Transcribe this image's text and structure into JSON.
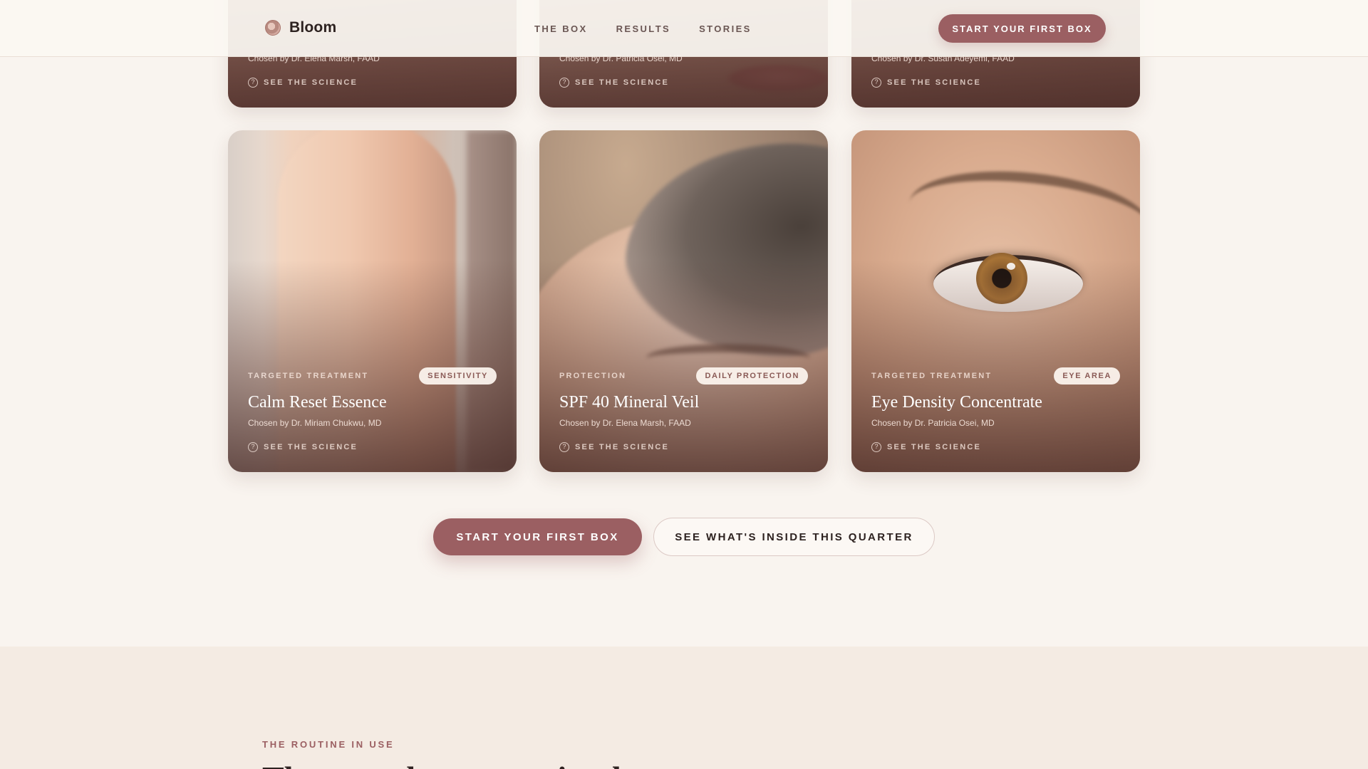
{
  "header": {
    "brand": "Bloom",
    "nav": [
      "THE BOX",
      "RESULTS",
      "STORIES"
    ],
    "cta": "START YOUR FIRST BOX"
  },
  "cards_top": [
    {
      "chosen_by": "Chosen by Dr. Elena Marsh, FAAD",
      "science": "SEE THE SCIENCE"
    },
    {
      "chosen_by": "Chosen by Dr. Patricia Osei, MD",
      "science": "SEE THE SCIENCE"
    },
    {
      "chosen_by": "Chosen by Dr. Susan Adeyemi, FAAD",
      "science": "SEE THE SCIENCE"
    }
  ],
  "cards": [
    {
      "category": "TARGETED TREATMENT",
      "tag": "SENSITIVITY",
      "title": "Calm Reset Essence",
      "chosen_by": "Chosen by Dr. Miriam Chukwu, MD",
      "science": "SEE THE SCIENCE"
    },
    {
      "category": "PROTECTION",
      "tag": "DAILY PROTECTION",
      "title": "SPF 40 Mineral Veil",
      "chosen_by": "Chosen by Dr. Elena Marsh, FAAD",
      "science": "SEE THE SCIENCE"
    },
    {
      "category": "TARGETED TREATMENT",
      "tag": "EYE AREA",
      "title": "Eye Density Concentrate",
      "chosen_by": "Chosen by Dr. Patricia Osei, MD",
      "science": "SEE THE SCIENCE"
    }
  ],
  "cta_row": {
    "primary": "START YOUR FIRST BOX",
    "secondary": "SEE WHAT'S INSIDE THIS QUARTER"
  },
  "next_section": {
    "eyebrow": "THE ROUTINE IN USE",
    "heading": "Three weeks, a new ritual"
  },
  "colors": {
    "accent": "#9b5f62",
    "background": "#f9f4ef",
    "section_alt": "#f4ebe3"
  },
  "icons": {
    "science": "question-circle-icon",
    "brand": "bloom-logo-icon"
  }
}
